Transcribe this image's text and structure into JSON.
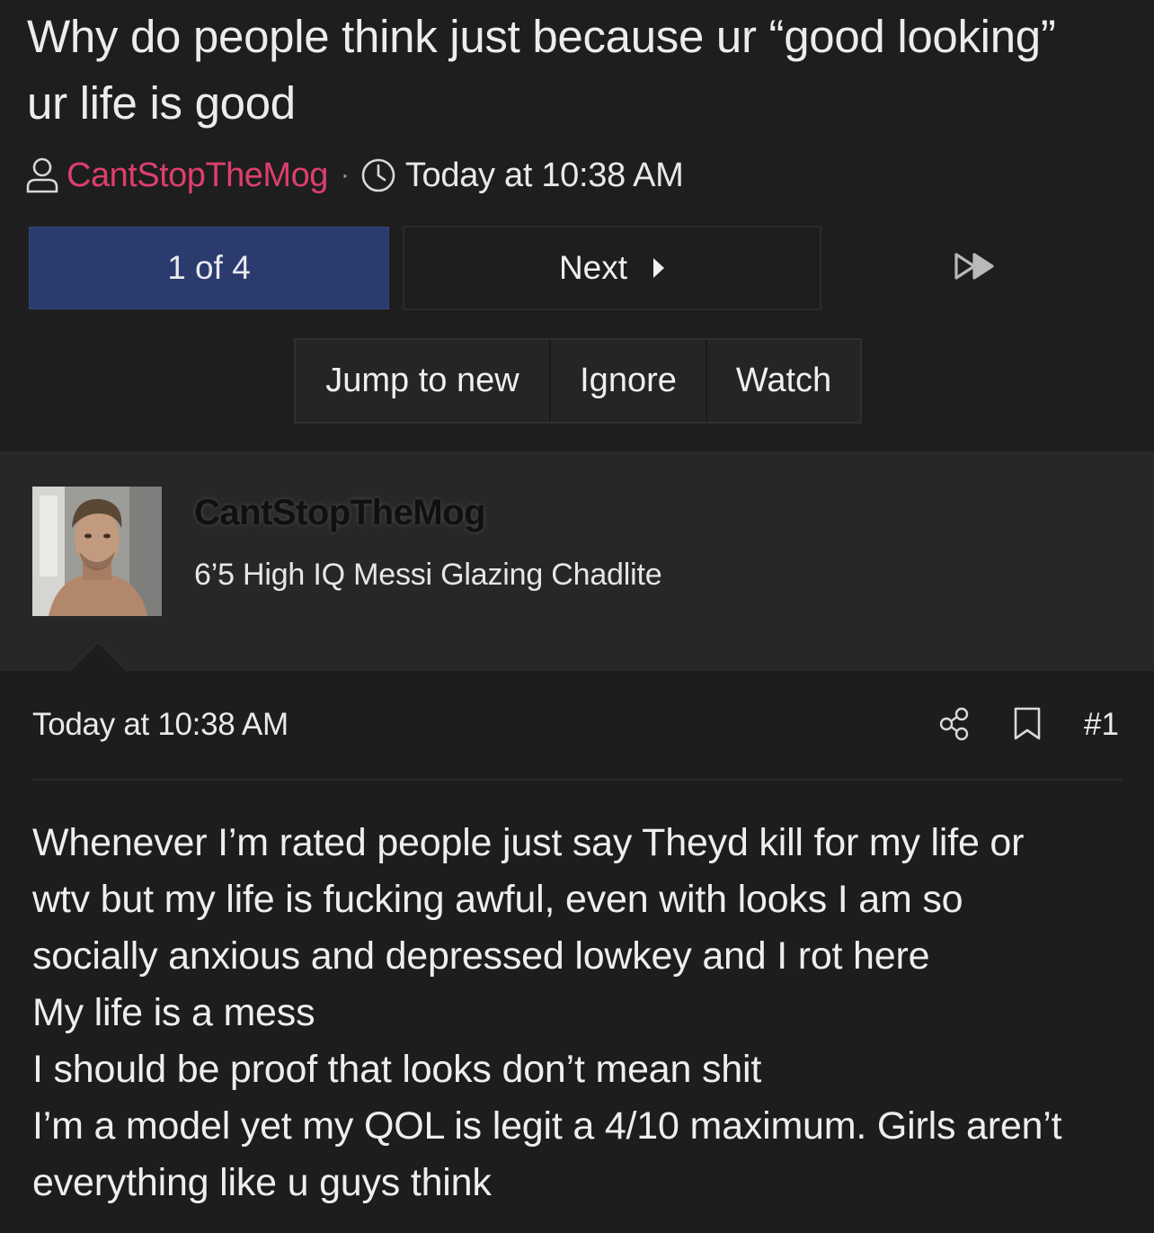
{
  "thread": {
    "title": "Why do people think just because ur “good looking” ur life is good",
    "author": "CantStopTheMog",
    "time": "Today at 10:38 AM",
    "separator": "·"
  },
  "pagination": {
    "current": "1 of 4",
    "next_label": "Next"
  },
  "actions": {
    "jump_label": "Jump to new",
    "ignore_label": "Ignore",
    "watch_label": "Watch"
  },
  "post": {
    "username": "CantStopTheMog",
    "user_title": "6’5 High IQ Messi Glazing Chadlite",
    "time": "Today at 10:38 AM",
    "number": "#1",
    "lines": [
      "Whenever I’m rated people just say Theyd kill for my life or",
      "wtv but my life is fucking awful, even with looks I am so",
      "socially anxious and depressed lowkey and I rot here",
      "My life is a mess",
      "I should be proof that looks don’t mean shit",
      "I’m a model yet my QOL is legit a 4/10 maximum. Girls aren’t",
      "everything like u guys think"
    ]
  },
  "icons": {
    "user": "user-icon",
    "clock": "clock-icon",
    "next": "caret-right-icon",
    "last": "fast-forward-icon",
    "share": "share-icon",
    "bookmark": "bookmark-icon"
  },
  "colors": {
    "author_link": "#de3f6c",
    "current_page": "#2b3b6e",
    "background": "#1d1d1e"
  }
}
